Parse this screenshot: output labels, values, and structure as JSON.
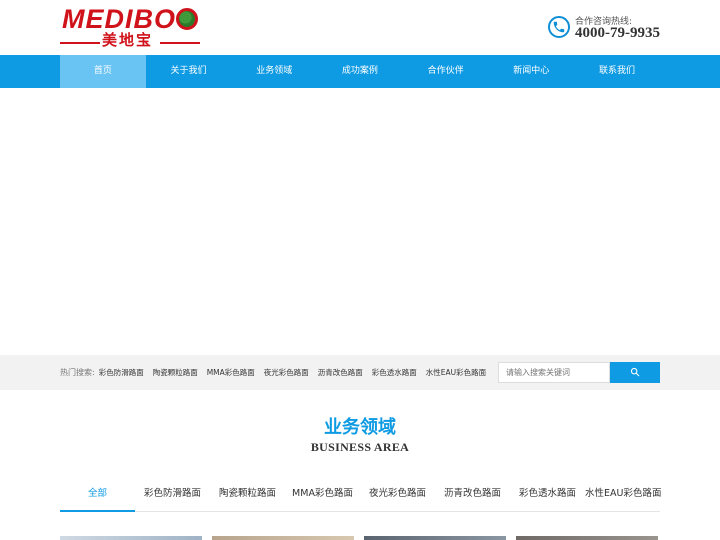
{
  "header": {
    "logo": {
      "word": "MEDIBO",
      "cn": "美地宝"
    },
    "hotline": {
      "label": "合作咨询热线:",
      "number": "4000-79-9935"
    }
  },
  "nav": {
    "items": [
      "首页",
      "关于我们",
      "业务领域",
      "成功案例",
      "合作伙伴",
      "新闻中心",
      "联系我们"
    ],
    "active_index": 0
  },
  "search": {
    "hot_title": "热门搜索:",
    "hot_links": [
      "彩色防滑路面",
      "陶瓷颗粒路面",
      "MMA彩色路面",
      "夜光彩色路面",
      "沥青改色路面",
      "彩色透水路面",
      "水性EAU彩色路面"
    ],
    "placeholder": "请输入搜索关键词"
  },
  "section": {
    "title": "业务领域",
    "subtitle": "BUSINESS AREA",
    "tabs": [
      "全部",
      "彩色防滑路面",
      "陶瓷颗粒路面",
      "MMA彩色路面",
      "夜光彩色路面",
      "沥青改色路面",
      "彩色透水路面",
      "水性EAU彩色路面"
    ],
    "active_tab": 0
  },
  "colors": {
    "brand_red": "#d0121b",
    "primary_blue": "#0f9be3",
    "nav_active": "#69c3f3"
  }
}
